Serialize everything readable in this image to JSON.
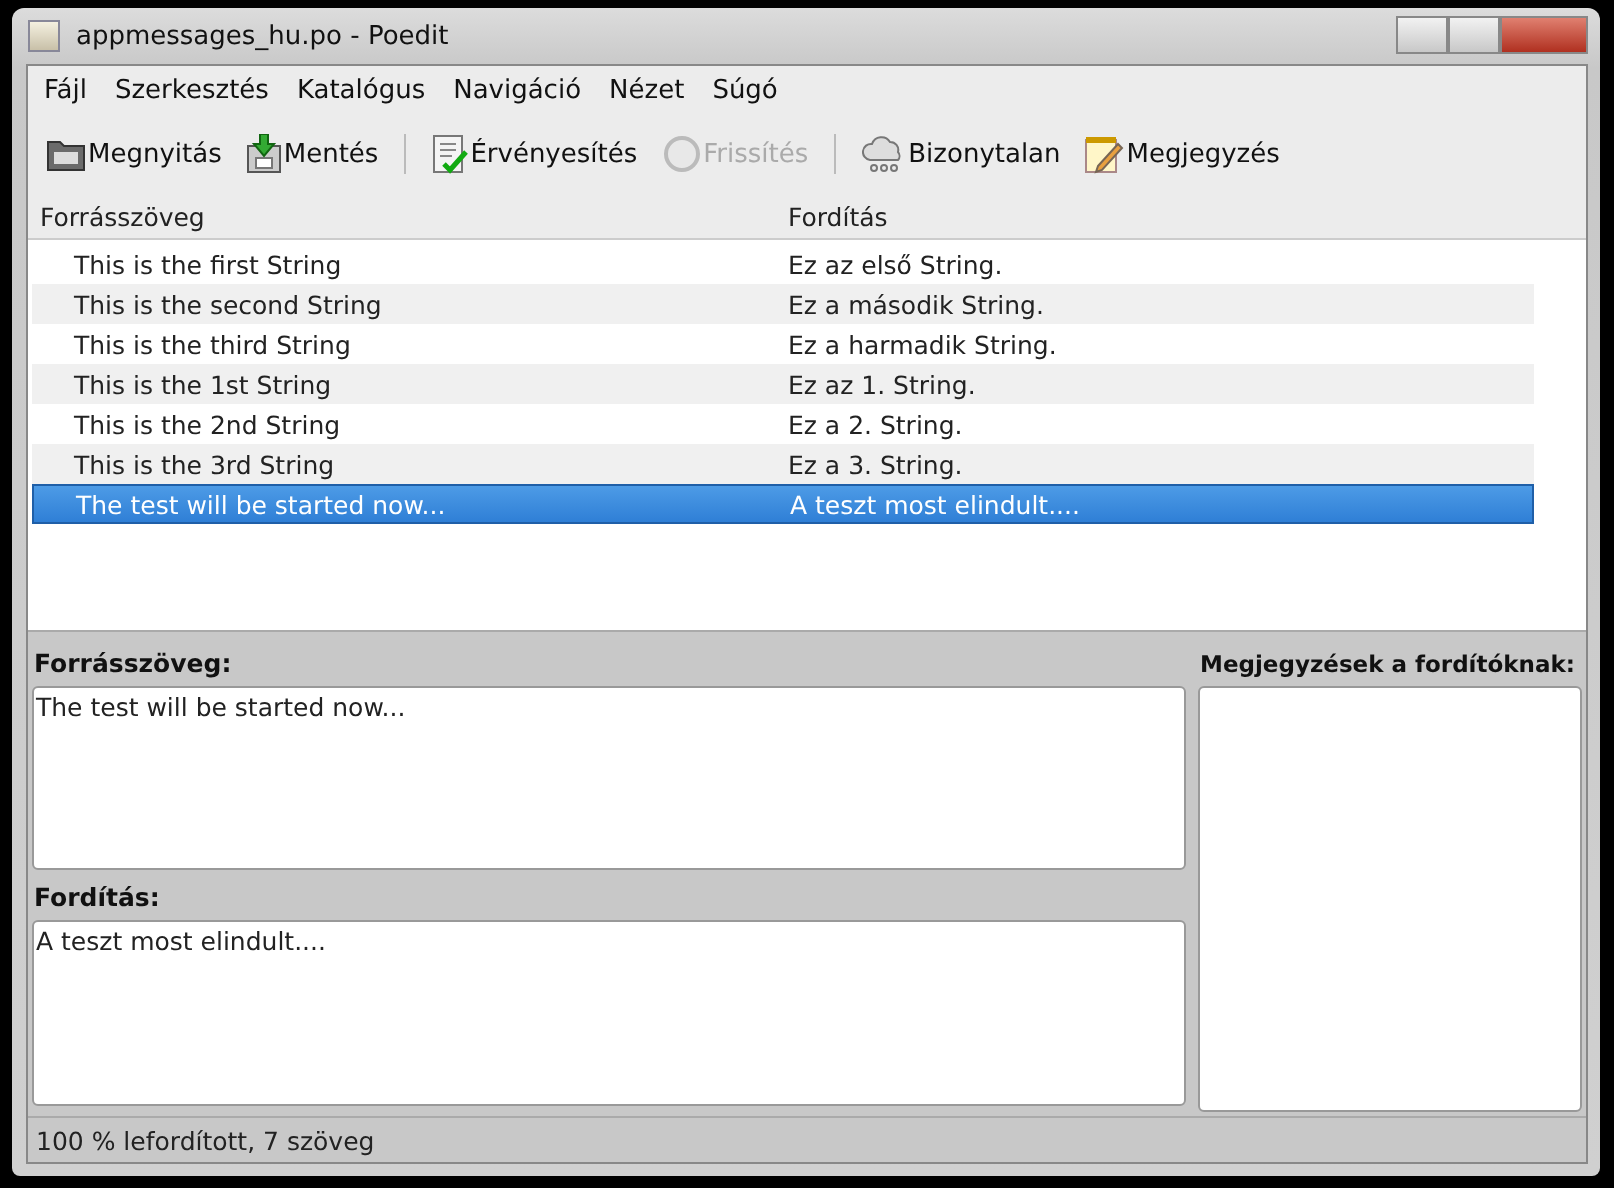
{
  "window": {
    "title": "appmessages_hu.po - Poedit"
  },
  "menu": [
    {
      "label": "Fájl"
    },
    {
      "label": "Szerkesztés"
    },
    {
      "label": "Katalógus"
    },
    {
      "label": "Navigáció"
    },
    {
      "label": "Nézet"
    },
    {
      "label": "Súgó"
    }
  ],
  "toolbar": [
    {
      "label": "Megnyitás",
      "kind": "open",
      "disabled": false,
      "separator_before": false
    },
    {
      "label": "Mentés",
      "kind": "save",
      "disabled": false,
      "separator_before": false
    },
    {
      "label": "Érvényesítés",
      "kind": "validate",
      "disabled": false,
      "separator_before": true
    },
    {
      "label": "Frissítés",
      "kind": "update",
      "disabled": true,
      "separator_before": false
    },
    {
      "label": "Bizonytalan",
      "kind": "fuzzy",
      "disabled": false,
      "separator_before": true
    },
    {
      "label": "Megjegyzés",
      "kind": "comment",
      "disabled": false,
      "separator_before": false
    }
  ],
  "table": {
    "columns": [
      "Forrásszöveg",
      "Fordítás"
    ],
    "rows": [
      {
        "source": "This is the first String",
        "translation": "Ez az első String.",
        "selected": false
      },
      {
        "source": "This is the second String",
        "translation": "Ez a második String.",
        "selected": false
      },
      {
        "source": "This is the third String",
        "translation": "Ez a harmadik String.",
        "selected": false
      },
      {
        "source": "This is the 1st String",
        "translation": "Ez az 1. String.",
        "selected": false
      },
      {
        "source": "This is the 2nd String",
        "translation": "Ez a 2. String.",
        "selected": false
      },
      {
        "source": "This is the 3rd String",
        "translation": "Ez a 3. String.",
        "selected": false
      },
      {
        "source": "The test will be started now...",
        "translation": "A teszt most elindult....",
        "selected": true
      }
    ]
  },
  "editor": {
    "source_label": "Forrásszöveg:",
    "source_text": "The test will be started now...",
    "translation_label": "Fordítás:",
    "translation_text": "A teszt most elindult....",
    "comments_label": "Megjegyzések a fordítóknak:"
  },
  "status_bar": "100 % lefordított, 7 szöveg"
}
